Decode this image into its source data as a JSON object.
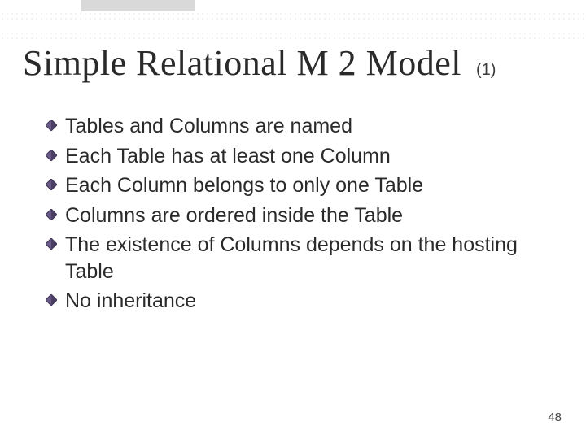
{
  "header": {
    "title": "Simple Relational M 2 Model",
    "suffix": "(1)"
  },
  "bullets": [
    "Tables and Columns are named",
    "Each Table has at least one Column",
    "Each Column belongs to only one Table",
    "Columns are ordered inside the Table",
    "The existence of Columns depends on the hosting Table",
    "No inheritance"
  ],
  "page_number": "48",
  "icons": {
    "bullet": "diamond-bullet-icon"
  },
  "colors": {
    "bullet_fill": "#6a5a8a",
    "bullet_stroke": "#3b3350"
  }
}
